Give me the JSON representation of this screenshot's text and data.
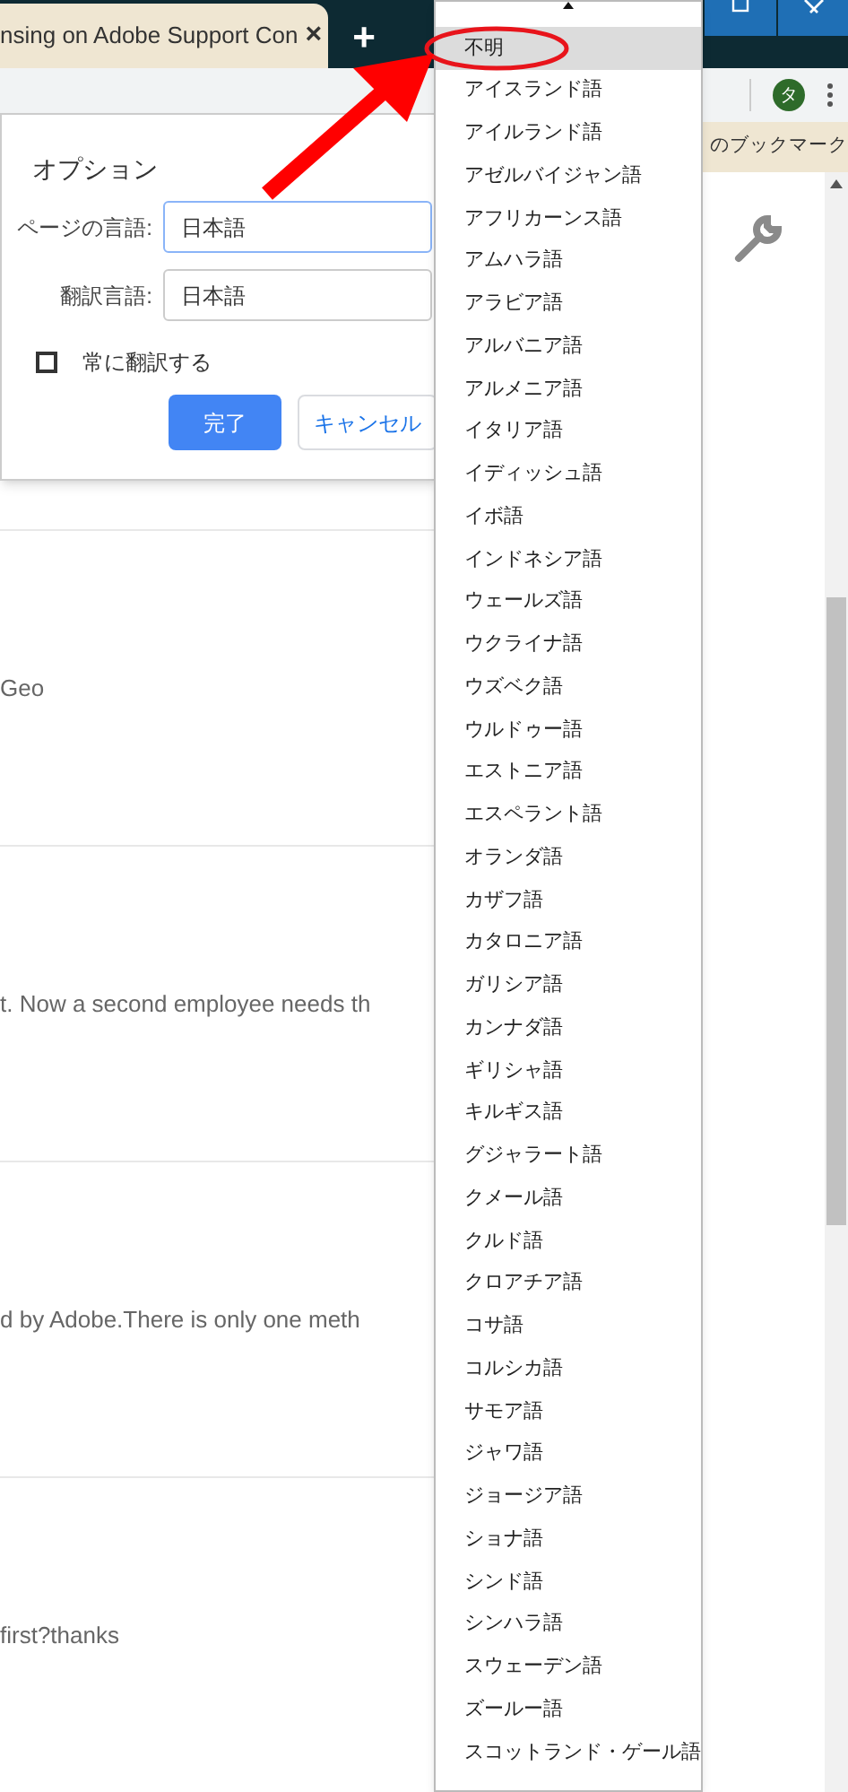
{
  "tab": {
    "title": "nsing on Adobe Support Con",
    "close": "×"
  },
  "new_tab": "+",
  "profile": {
    "initial": "タ"
  },
  "bookmarks": {
    "other": "のブックマーク"
  },
  "dialog": {
    "title": "オプション",
    "fields": [
      {
        "label": "ページの言語:",
        "value": "日本語",
        "focused": true
      },
      {
        "label": "翻訳言語:",
        "value": "日本語",
        "focused": false
      }
    ],
    "checkbox": {
      "label": "常に翻訳する",
      "checked": false
    },
    "buttons": [
      {
        "label": "完了",
        "kind": "primary"
      },
      {
        "label": "キャンセル",
        "kind": "secondary"
      }
    ]
  },
  "page_rows": [
    "Geo",
    "t. Now a second employee needs th",
    "d by Adobe.There is only one meth",
    "first?thanks"
  ],
  "language_list": [
    {
      "label": "不明",
      "selected": true
    },
    {
      "label": "アイスランド語",
      "selected": false
    },
    {
      "label": "アイルランド語",
      "selected": false
    },
    {
      "label": "アゼルバイジャン語",
      "selected": false
    },
    {
      "label": "アフリカーンス語",
      "selected": false
    },
    {
      "label": "アムハラ語",
      "selected": false
    },
    {
      "label": "アラビア語",
      "selected": false
    },
    {
      "label": "アルバニア語",
      "selected": false
    },
    {
      "label": "アルメニア語",
      "selected": false
    },
    {
      "label": "イタリア語",
      "selected": false
    },
    {
      "label": "イディッシュ語",
      "selected": false
    },
    {
      "label": "イボ語",
      "selected": false
    },
    {
      "label": "インドネシア語",
      "selected": false
    },
    {
      "label": "ウェールズ語",
      "selected": false
    },
    {
      "label": "ウクライナ語",
      "selected": false
    },
    {
      "label": "ウズベク語",
      "selected": false
    },
    {
      "label": "ウルドゥー語",
      "selected": false
    },
    {
      "label": "エストニア語",
      "selected": false
    },
    {
      "label": "エスペラント語",
      "selected": false
    },
    {
      "label": "オランダ語",
      "selected": false
    },
    {
      "label": "カザフ語",
      "selected": false
    },
    {
      "label": "カタロニア語",
      "selected": false
    },
    {
      "label": "ガリシア語",
      "selected": false
    },
    {
      "label": "カンナダ語",
      "selected": false
    },
    {
      "label": "ギリシャ語",
      "selected": false
    },
    {
      "label": "キルギス語",
      "selected": false
    },
    {
      "label": "グジャラート語",
      "selected": false
    },
    {
      "label": "クメール語",
      "selected": false
    },
    {
      "label": "クルド語",
      "selected": false
    },
    {
      "label": "クロアチア語",
      "selected": false
    },
    {
      "label": "コサ語",
      "selected": false
    },
    {
      "label": "コルシカ語",
      "selected": false
    },
    {
      "label": "サモア語",
      "selected": false
    },
    {
      "label": "ジャワ語",
      "selected": false
    },
    {
      "label": "ジョージア語",
      "selected": false
    },
    {
      "label": "ショナ語",
      "selected": false
    },
    {
      "label": "シンド語",
      "selected": false
    },
    {
      "label": "シンハラ語",
      "selected": false
    },
    {
      "label": "スウェーデン語",
      "selected": false
    },
    {
      "label": "ズールー語",
      "selected": false
    },
    {
      "label": "スコットランド・ゲール語",
      "selected": false
    }
  ]
}
